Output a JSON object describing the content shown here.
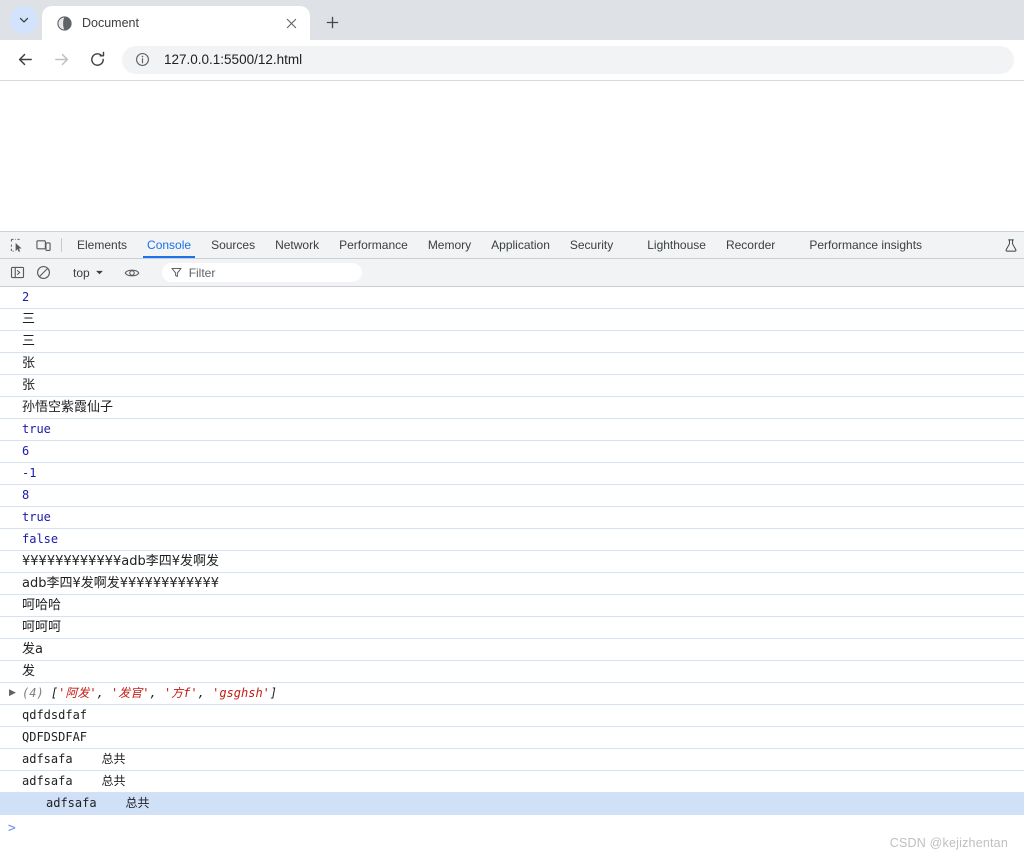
{
  "browser": {
    "tab": {
      "title": "Document",
      "favicon_icon": "globe-icon",
      "close_icon": "close-icon"
    },
    "tab_search_icon": "chevron-down-icon",
    "new_tab_icon": "plus-icon",
    "nav": {
      "back_icon": "arrow-left-icon",
      "forward_icon": "arrow-right-icon",
      "reload_icon": "reload-icon"
    },
    "omnibox": {
      "info_icon": "info-circle-icon",
      "url": "127.0.0.1:5500/12.html"
    }
  },
  "devtools": {
    "left_icons": [
      {
        "name": "inspect-element-icon"
      },
      {
        "name": "device-toolbar-icon"
      }
    ],
    "tabs": [
      {
        "label": "Elements",
        "active": false,
        "spaced": false
      },
      {
        "label": "Console",
        "active": true,
        "spaced": false
      },
      {
        "label": "Sources",
        "active": false,
        "spaced": false
      },
      {
        "label": "Network",
        "active": false,
        "spaced": false
      },
      {
        "label": "Performance",
        "active": false,
        "spaced": false
      },
      {
        "label": "Memory",
        "active": false,
        "spaced": false
      },
      {
        "label": "Application",
        "active": false,
        "spaced": false
      },
      {
        "label": "Security",
        "active": false,
        "spaced": false
      },
      {
        "label": "Lighthouse",
        "active": false,
        "spaced": true
      },
      {
        "label": "Recorder",
        "active": false,
        "spaced": false
      },
      {
        "label": "Performance insights",
        "active": false,
        "spaced": true
      }
    ],
    "flask_icon": "flask-icon",
    "filterbar": {
      "sidebar_icon": "console-sidebar-icon",
      "clear_icon": "clear-console-icon",
      "context_value": "top",
      "context_chevron_icon": "chevron-down-icon",
      "eye_icon": "live-expression-eye-icon",
      "filter_icon": "filter-funnel-icon",
      "filter_placeholder": "Filter"
    },
    "console": {
      "prompt_icon": "prompt-chevron-icon",
      "rows": [
        {
          "text": "2",
          "style": "num"
        },
        {
          "text": "三",
          "style": "cjk"
        },
        {
          "text": "三",
          "style": "cjk"
        },
        {
          "text": "张",
          "style": "cjk"
        },
        {
          "text": "张",
          "style": "cjk"
        },
        {
          "text": "孙悟空紫霞仙子",
          "style": "cjk"
        },
        {
          "text": "true",
          "style": "num"
        },
        {
          "text": "6",
          "style": "num"
        },
        {
          "text": "-1",
          "style": "num"
        },
        {
          "text": "8",
          "style": "num"
        },
        {
          "text": "true",
          "style": "num"
        },
        {
          "text": "false",
          "style": "num"
        },
        {
          "text": "¥¥¥¥¥¥¥¥¥¥¥¥adb李四¥发啊发",
          "style": "cjk"
        },
        {
          "text": "adb李四¥发啊发¥¥¥¥¥¥¥¥¥¥¥¥",
          "style": "cjk"
        },
        {
          "text": "呵哈哈",
          "style": "cjk"
        },
        {
          "text": "呵呵呵",
          "style": "cjk"
        },
        {
          "text": "发a",
          "style": "cjk"
        },
        {
          "text": "发",
          "style": "cjk"
        },
        {
          "text": "",
          "style": "array"
        },
        {
          "text": "qdfdsdfaf",
          "style": "plain"
        },
        {
          "text": "QDFDSDFAF",
          "style": "plain"
        },
        {
          "text": "adfsafa    总共",
          "style": "plain"
        },
        {
          "text": "adfsafa    总共",
          "style": "plain"
        },
        {
          "text": "adfsafa    总共",
          "style": "selected"
        }
      ],
      "array_row": {
        "expand_icon": "expand-triangle-icon",
        "count": "(4)",
        "open": "[",
        "items": [
          "'阿发'",
          "'发官'",
          "'方f'",
          "'gsghsh'"
        ],
        "separator": ", ",
        "close": "]"
      }
    }
  },
  "watermark": "CSDN @kejizhentan"
}
